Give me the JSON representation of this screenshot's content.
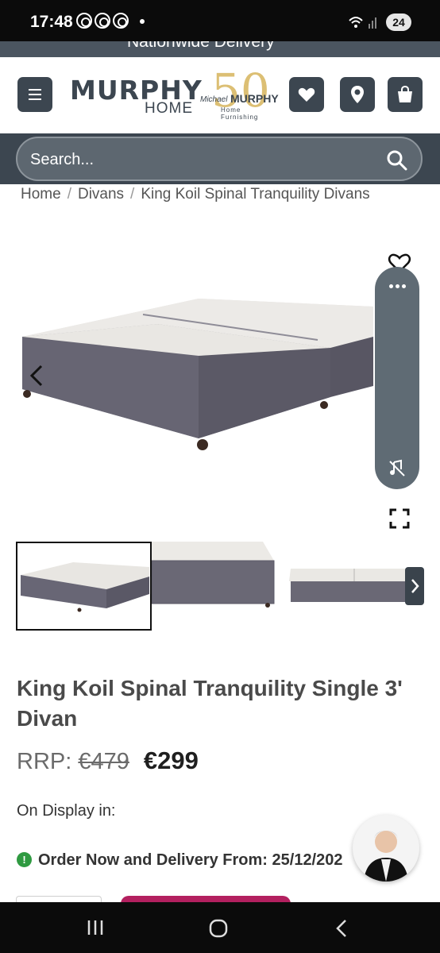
{
  "status_bar": {
    "time": "17:48",
    "battery": "24"
  },
  "promo": {
    "text": "Nationwide Delivery"
  },
  "header": {
    "logo_line1": "MURPHY",
    "logo_line2": "HOME",
    "anniversary_number": "50",
    "anniversary_brand_script": "Michael",
    "anniversary_brand": "MURPHY",
    "anniversary_sub": "Home Furnishing"
  },
  "search": {
    "placeholder": "Search..."
  },
  "breadcrumb": {
    "home": "Home",
    "category": "Divans",
    "current": "King Koil Spinal Tranquility Divans"
  },
  "product": {
    "title": "King Koil Spinal Tranquility Single 3' Divan",
    "rrp_label": "RRP:",
    "rrp_price": "€479",
    "price": "€299",
    "on_display": "On Display in:",
    "delivery": "Order Now and Delivery From: 25/12/202"
  },
  "colors": {
    "brand_dark": "#3c4650",
    "accent_gold": "#d7b55c",
    "status_green": "#2f9a41",
    "cart_magenta": "#b3205f"
  },
  "icons": [
    "menu-icon",
    "heart-icon",
    "location-pin-icon",
    "shopping-bag-icon",
    "search-icon",
    "chevron-left-icon",
    "wishlist-heart-icon",
    "more-dots-icon",
    "mute-icon",
    "fullscreen-icon",
    "chevron-right-icon",
    "checkmark-icon"
  ]
}
